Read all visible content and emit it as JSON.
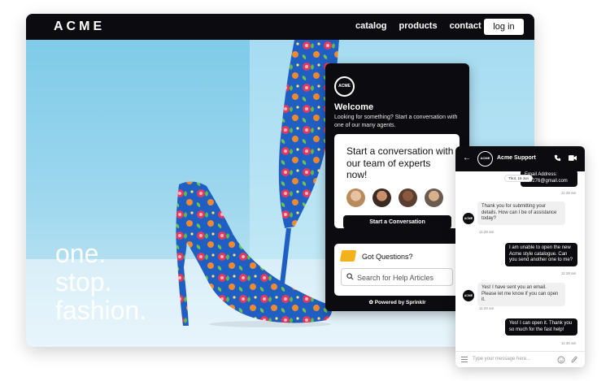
{
  "site": {
    "logo": "ACME",
    "nav": [
      "catalog",
      "products",
      "contact"
    ],
    "login_label": "log in",
    "tagline": [
      "one.",
      "stop.",
      "fashion."
    ]
  },
  "widget": {
    "avatar_text": "ACME",
    "title": "Welcome",
    "subtitle": "Looking for something? Start a conversation with one of our many agents.",
    "card_heading": "Start a conversation with our team of experts now!",
    "start_button": "Start a Conversation",
    "help_title": "Got Questions?",
    "search_placeholder": "Search for Help Articles",
    "powered": "Powered by Sprinklr"
  },
  "chat": {
    "name": "Acme Support",
    "avatar_text": "ACME",
    "date": "Thur, 16 Jun",
    "partial_out": [
      "Email Address:",
      "…0276@gmail.com"
    ],
    "messages": [
      {
        "dir": "in",
        "text": "Thank you for submitting your details. How can I be of assistance today?",
        "time": "11:28 am"
      },
      {
        "dir": "out",
        "text": "I am unable to open the new Acme style catalogue. Can you send another one to me?",
        "time": "11:28 am"
      },
      {
        "dir": "in",
        "text": "Yes! I have sent you an email. Please let me know if you can open it.",
        "time": "11:28 am"
      },
      {
        "dir": "out",
        "text": "Yes! I can open it. Thank you so much for the fast help!",
        "time": "11:30 am"
      }
    ],
    "first_time": "11:28 am",
    "input_placeholder": "Type your message here..."
  },
  "colors": {
    "dark": "#0c0c10",
    "accent_yellow": "#f2b21b"
  }
}
